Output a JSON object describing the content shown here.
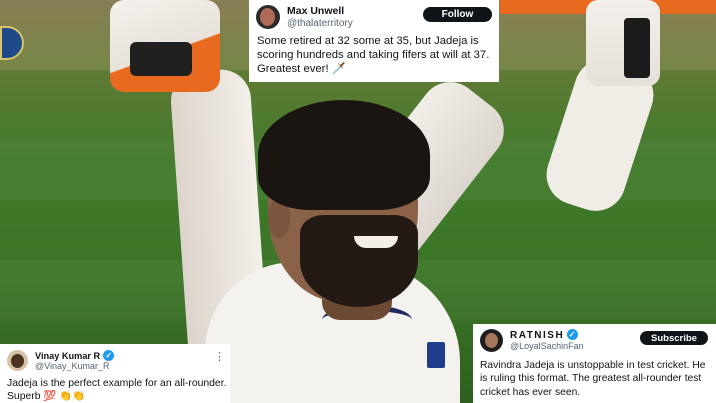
{
  "tweets": [
    {
      "name": "Max Unwell",
      "handle": "@thalaterritory",
      "button": "Follow",
      "text": "Some retired at 32 some at 35, but Jadeja is scoring hundreds and taking fifers at will at 37. Greatest ever! 🗡️"
    },
    {
      "name": "Vinay Kumar R",
      "handle": "@Vinay_Kumar_R",
      "verified": true,
      "text": "Jadeja is the perfect example for an all-rounder. Superb 💯 👏👏"
    },
    {
      "name": "RATNISH",
      "handle": "@LoyalSachinFan",
      "verified": true,
      "button": "Subscribe",
      "text": "Ravindra Jadeja is unstoppable in test cricket. He is ruling this format. The greatest all-rounder test cricket has ever seen."
    }
  ],
  "colors": {
    "verified": "#1d9bf0",
    "button_bg": "#0f1419",
    "pitch_green": "#3f7a2a",
    "glove_orange": "#e86a1f"
  },
  "icons": {
    "menu": "more-dots-icon",
    "verified": "verified-badge-icon"
  }
}
